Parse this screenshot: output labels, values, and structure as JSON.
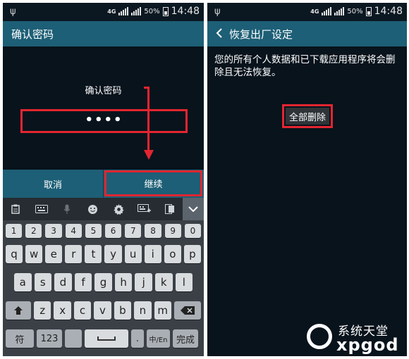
{
  "left_screen": {
    "status": {
      "network": "4G",
      "battery": "50%",
      "time": "14:48"
    },
    "title": "确认密码",
    "prompt": "确认密码",
    "password_value": "••••",
    "buttons": {
      "cancel": "取消",
      "continue": "继续"
    },
    "keyboard": {
      "toolbar_icons": [
        "clipboard-icon",
        "keyboard-icon",
        "microphone-icon",
        "emoji-icon",
        "settings-icon",
        "keyboard-resize-icon",
        "one-hand-icon",
        "chevron-down-icon"
      ],
      "number_row": [
        "1",
        "2",
        "3",
        "4",
        "5",
        "6",
        "7",
        "8",
        "9",
        "0"
      ],
      "row1": [
        "q",
        "w",
        "e",
        "r",
        "t",
        "y",
        "u",
        "i",
        "o",
        "p"
      ],
      "row2": [
        "a",
        "s",
        "d",
        "f",
        "g",
        "h",
        "j",
        "k",
        "l"
      ],
      "row3": [
        "z",
        "x",
        "c",
        "v",
        "b",
        "n",
        "m"
      ],
      "bottom": {
        "symbols": "符",
        "numbers": "123",
        "period": ".",
        "lang": "中/En",
        "done": "完成"
      }
    }
  },
  "right_screen": {
    "status": {
      "network": "4G",
      "battery": "50%",
      "time": "14:48"
    },
    "title": "恢复出厂设定",
    "warning": "您的所有个人数据和已下载应用程序将会删除且无法恢复。",
    "delete_all": "全部删除"
  },
  "watermark": {
    "cn": "系统天堂",
    "en": "xpgod"
  },
  "colors": {
    "accent_red": "#e32530",
    "action_bar": "#1d5f76",
    "background": "#08131c"
  }
}
